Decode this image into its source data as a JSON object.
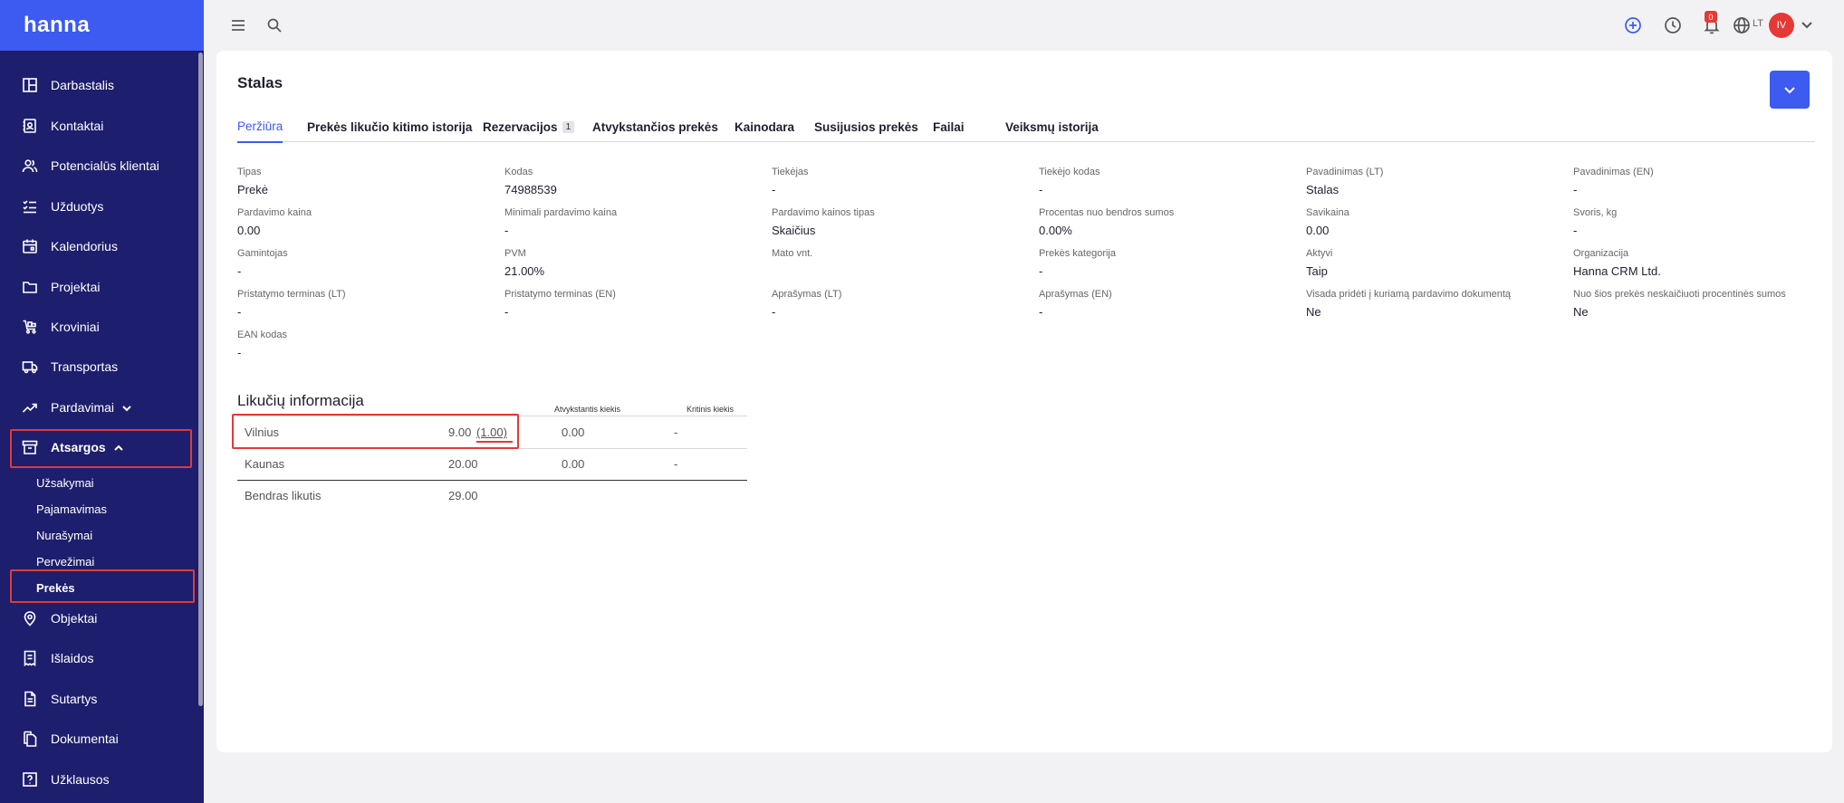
{
  "app": {
    "logo": "hanna"
  },
  "sidebar": {
    "items": [
      {
        "label": "Darbastalis",
        "icon": "dashboard-icon"
      },
      {
        "label": "Kontaktai",
        "icon": "contacts-icon"
      },
      {
        "label": "Potencialūs klientai",
        "icon": "people-icon"
      },
      {
        "label": "Užduotys",
        "icon": "tasks-icon"
      },
      {
        "label": "Kalendorius",
        "icon": "calendar-icon"
      },
      {
        "label": "Projektai",
        "icon": "folder-icon"
      },
      {
        "label": "Kroviniai",
        "icon": "cart-icon"
      },
      {
        "label": "Transportas",
        "icon": "truck-icon"
      },
      {
        "label": "Pardavimai",
        "icon": "trending-icon"
      },
      {
        "label": "Atsargos",
        "icon": "archive-icon"
      },
      {
        "label": "Objektai",
        "icon": "location-icon"
      },
      {
        "label": "Išlaidos",
        "icon": "receipt-icon"
      },
      {
        "label": "Sutartys",
        "icon": "contract-icon"
      },
      {
        "label": "Dokumentai",
        "icon": "documents-icon"
      },
      {
        "label": "Užklausos",
        "icon": "question-icon"
      }
    ],
    "sub_items": [
      {
        "label": "Užsakymai"
      },
      {
        "label": "Pajamavimas"
      },
      {
        "label": "Nurašymai"
      },
      {
        "label": "Pervežimai"
      },
      {
        "label": "Prekės"
      }
    ]
  },
  "topbar": {
    "notifications_count": "0",
    "language": "LT",
    "user_initials": "IV"
  },
  "page": {
    "title": "Stalas",
    "tabs": [
      {
        "label": "Peržiūra"
      },
      {
        "label": "Prekės likučio kitimo istorija"
      },
      {
        "label": "Rezervacijos",
        "count": "1"
      },
      {
        "label": "Atvykstančios prekės"
      },
      {
        "label": "Kainodara"
      },
      {
        "label": "Susijusios prekės"
      },
      {
        "label": "Failai"
      },
      {
        "label": "Veiksmų istorija"
      }
    ],
    "fields": [
      {
        "label": "Tipas",
        "value": "Prekė"
      },
      {
        "label": "Kodas",
        "value": "74988539"
      },
      {
        "label": "Tiekėjas",
        "value": "-"
      },
      {
        "label": "Tiekėjo kodas",
        "value": "-"
      },
      {
        "label": "Pavadinimas (LT)",
        "value": "Stalas"
      },
      {
        "label": "Pavadinimas (EN)",
        "value": "-"
      },
      {
        "label": "Pardavimo kaina",
        "value": "0.00"
      },
      {
        "label": "Minimali pardavimo kaina",
        "value": "-"
      },
      {
        "label": "Pardavimo kainos tipas",
        "value": "Skaičius"
      },
      {
        "label": "Procentas nuo bendros sumos",
        "value": "0.00%"
      },
      {
        "label": "Savikaina",
        "value": "0.00"
      },
      {
        "label": "Svoris, kg",
        "value": "-"
      },
      {
        "label": "Gamintojas",
        "value": "-"
      },
      {
        "label": "PVM",
        "value": "21.00%"
      },
      {
        "label": "Mato vnt.",
        "value": ""
      },
      {
        "label": "Prekės kategorija",
        "value": "-"
      },
      {
        "label": "Aktyvi",
        "value": "Taip"
      },
      {
        "label": "Organizacija",
        "value": "Hanna CRM Ltd."
      },
      {
        "label": "Pristatymo terminas (LT)",
        "value": "-"
      },
      {
        "label": "Pristatymo terminas (EN)",
        "value": "-"
      },
      {
        "label": "Aprašymas (LT)",
        "value": "-"
      },
      {
        "label": "Aprašymas (EN)",
        "value": "-"
      },
      {
        "label": "Visada pridėti į kuriamą pardavimo dokumentą",
        "value": "Ne"
      },
      {
        "label": "Nuo šios prekės neskaičiuoti procentinės sumos",
        "value": "Ne"
      },
      {
        "label": "EAN kodas",
        "value": "-"
      }
    ],
    "stock": {
      "title": "Likučių informacija",
      "headers": {
        "incoming": "Atvykstantis kiekis",
        "critical": "Kritinis kiekis"
      },
      "rows": [
        {
          "location": "Vilnius",
          "qty": "9.00",
          "reserved": "(1.00)",
          "incoming": "0.00",
          "critical": "-"
        },
        {
          "location": "Kaunas",
          "qty": "20.00",
          "reserved": "",
          "incoming": "0.00",
          "critical": "-"
        }
      ],
      "total": {
        "label": "Bendras likutis",
        "qty": "29.00"
      }
    }
  }
}
